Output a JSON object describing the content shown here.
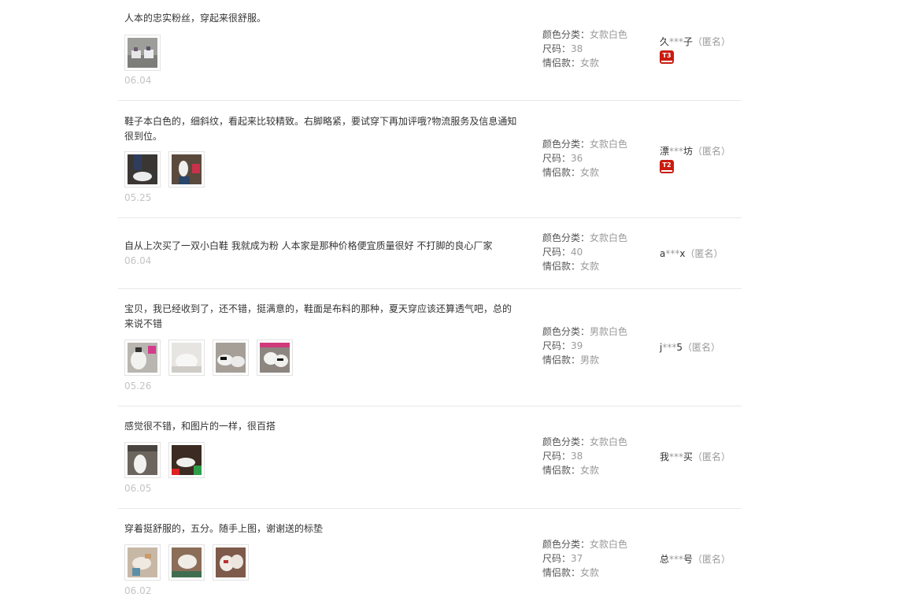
{
  "labels": {
    "color": "颜色分类：",
    "size": "尺码：",
    "couple": "情侣款：",
    "anon": "（匿名）"
  },
  "reviews": [
    {
      "text": "人本的忠实粉丝，穿起来很舒服。",
      "date": "06.04",
      "images": 1,
      "color": "女款白色",
      "size": "38",
      "couple": "女款",
      "user_first": "久",
      "user_mask": "***",
      "user_last": "子",
      "badge": "T3"
    },
    {
      "text": "鞋子本白色的，细斜纹，看起来比较精致。右脚略紧，要试穿下再加评哦?物流服务及信息通知很到位。",
      "date": "05.25",
      "images": 2,
      "color": "女款白色",
      "size": "36",
      "couple": "女款",
      "user_first": "漂",
      "user_mask": "***",
      "user_last": "坊",
      "badge": "T2"
    },
    {
      "text": "自从上次买了一双小白鞋 我就成为粉 人本家是那种价格便宜质量很好 不打脚的良心厂家",
      "date": "06.04",
      "images": 0,
      "color": "女款白色",
      "size": "40",
      "couple": "女款",
      "user_first": "a",
      "user_mask": "***",
      "user_last": "x",
      "badge": ""
    },
    {
      "text": "宝贝，我已经收到了，还不错，挺满意的，鞋面是布料的那种，夏天穿应该还算透气吧，总的来说不错",
      "date": "05.26",
      "images": 4,
      "color": "男款白色",
      "size": "39",
      "couple": "男款",
      "user_first": "j",
      "user_mask": "***",
      "user_last": "5",
      "badge": ""
    },
    {
      "text": "感觉很不错，和图片的一样，很百搭",
      "date": "06.05",
      "images": 2,
      "color": "女款白色",
      "size": "38",
      "couple": "女款",
      "user_first": "我",
      "user_mask": "***",
      "user_last": "买",
      "badge": ""
    },
    {
      "text": "穿着挺舒服的，五分。随手上图，谢谢送的标垫",
      "date": "06.02",
      "images": 3,
      "color": "女款白色",
      "size": "37",
      "couple": "女款",
      "user_first": "总",
      "user_mask": "***",
      "user_last": "号",
      "badge": ""
    }
  ]
}
